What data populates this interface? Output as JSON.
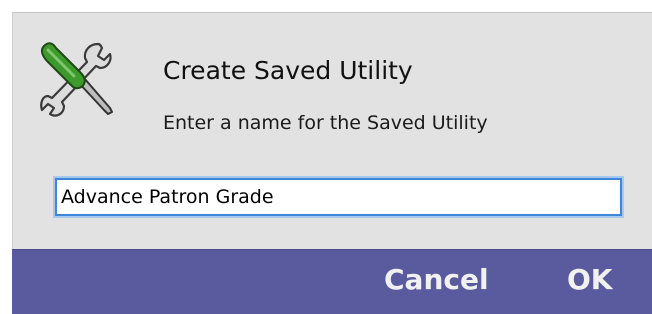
{
  "dialog": {
    "title": "Create Saved Utility",
    "prompt": "Enter a name for the Saved Utility",
    "icon": "tools-icon",
    "name_input": {
      "value": "Advance Patron Grade",
      "placeholder": ""
    },
    "buttons": {
      "cancel": "Cancel",
      "ok": "OK"
    }
  },
  "colors": {
    "dialog_background": "#e2e2e2",
    "button_bar": "#5a5b9f",
    "button_text": "#f1f1f1",
    "input_focus_border": "#3f86d8",
    "screwdriver_handle": "#3f9a2e"
  }
}
